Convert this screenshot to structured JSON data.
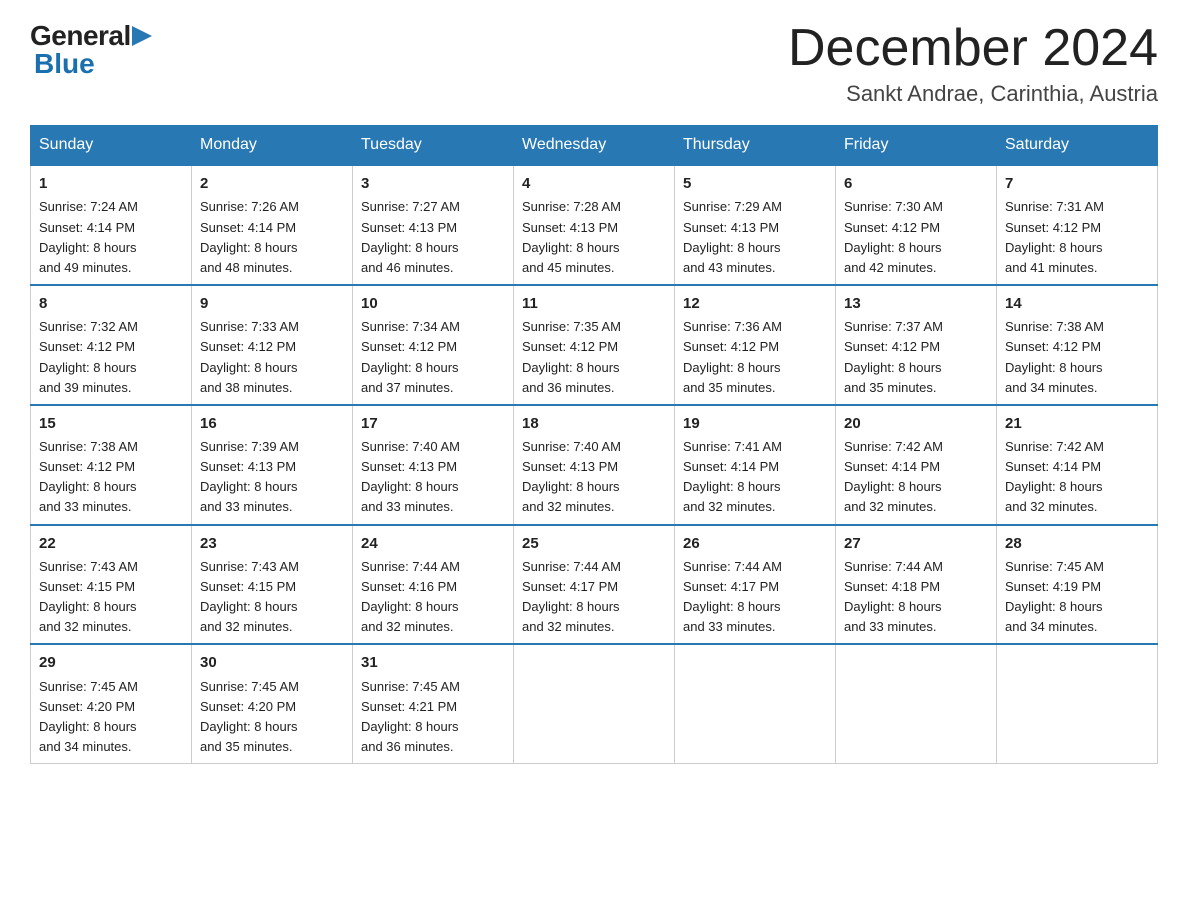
{
  "header": {
    "logo_general": "General",
    "logo_blue": "Blue",
    "month_title": "December 2024",
    "location": "Sankt Andrae, Carinthia, Austria"
  },
  "days_of_week": [
    "Sunday",
    "Monday",
    "Tuesday",
    "Wednesday",
    "Thursday",
    "Friday",
    "Saturday"
  ],
  "weeks": [
    [
      {
        "day": "1",
        "sunrise": "7:24 AM",
        "sunset": "4:14 PM",
        "daylight": "8 hours and 49 minutes."
      },
      {
        "day": "2",
        "sunrise": "7:26 AM",
        "sunset": "4:14 PM",
        "daylight": "8 hours and 48 minutes."
      },
      {
        "day": "3",
        "sunrise": "7:27 AM",
        "sunset": "4:13 PM",
        "daylight": "8 hours and 46 minutes."
      },
      {
        "day": "4",
        "sunrise": "7:28 AM",
        "sunset": "4:13 PM",
        "daylight": "8 hours and 45 minutes."
      },
      {
        "day": "5",
        "sunrise": "7:29 AM",
        "sunset": "4:13 PM",
        "daylight": "8 hours and 43 minutes."
      },
      {
        "day": "6",
        "sunrise": "7:30 AM",
        "sunset": "4:12 PM",
        "daylight": "8 hours and 42 minutes."
      },
      {
        "day": "7",
        "sunrise": "7:31 AM",
        "sunset": "4:12 PM",
        "daylight": "8 hours and 41 minutes."
      }
    ],
    [
      {
        "day": "8",
        "sunrise": "7:32 AM",
        "sunset": "4:12 PM",
        "daylight": "8 hours and 39 minutes."
      },
      {
        "day": "9",
        "sunrise": "7:33 AM",
        "sunset": "4:12 PM",
        "daylight": "8 hours and 38 minutes."
      },
      {
        "day": "10",
        "sunrise": "7:34 AM",
        "sunset": "4:12 PM",
        "daylight": "8 hours and 37 minutes."
      },
      {
        "day": "11",
        "sunrise": "7:35 AM",
        "sunset": "4:12 PM",
        "daylight": "8 hours and 36 minutes."
      },
      {
        "day": "12",
        "sunrise": "7:36 AM",
        "sunset": "4:12 PM",
        "daylight": "8 hours and 35 minutes."
      },
      {
        "day": "13",
        "sunrise": "7:37 AM",
        "sunset": "4:12 PM",
        "daylight": "8 hours and 35 minutes."
      },
      {
        "day": "14",
        "sunrise": "7:38 AM",
        "sunset": "4:12 PM",
        "daylight": "8 hours and 34 minutes."
      }
    ],
    [
      {
        "day": "15",
        "sunrise": "7:38 AM",
        "sunset": "4:12 PM",
        "daylight": "8 hours and 33 minutes."
      },
      {
        "day": "16",
        "sunrise": "7:39 AM",
        "sunset": "4:13 PM",
        "daylight": "8 hours and 33 minutes."
      },
      {
        "day": "17",
        "sunrise": "7:40 AM",
        "sunset": "4:13 PM",
        "daylight": "8 hours and 33 minutes."
      },
      {
        "day": "18",
        "sunrise": "7:40 AM",
        "sunset": "4:13 PM",
        "daylight": "8 hours and 32 minutes."
      },
      {
        "day": "19",
        "sunrise": "7:41 AM",
        "sunset": "4:14 PM",
        "daylight": "8 hours and 32 minutes."
      },
      {
        "day": "20",
        "sunrise": "7:42 AM",
        "sunset": "4:14 PM",
        "daylight": "8 hours and 32 minutes."
      },
      {
        "day": "21",
        "sunrise": "7:42 AM",
        "sunset": "4:14 PM",
        "daylight": "8 hours and 32 minutes."
      }
    ],
    [
      {
        "day": "22",
        "sunrise": "7:43 AM",
        "sunset": "4:15 PM",
        "daylight": "8 hours and 32 minutes."
      },
      {
        "day": "23",
        "sunrise": "7:43 AM",
        "sunset": "4:15 PM",
        "daylight": "8 hours and 32 minutes."
      },
      {
        "day": "24",
        "sunrise": "7:44 AM",
        "sunset": "4:16 PM",
        "daylight": "8 hours and 32 minutes."
      },
      {
        "day": "25",
        "sunrise": "7:44 AM",
        "sunset": "4:17 PM",
        "daylight": "8 hours and 32 minutes."
      },
      {
        "day": "26",
        "sunrise": "7:44 AM",
        "sunset": "4:17 PM",
        "daylight": "8 hours and 33 minutes."
      },
      {
        "day": "27",
        "sunrise": "7:44 AM",
        "sunset": "4:18 PM",
        "daylight": "8 hours and 33 minutes."
      },
      {
        "day": "28",
        "sunrise": "7:45 AM",
        "sunset": "4:19 PM",
        "daylight": "8 hours and 34 minutes."
      }
    ],
    [
      {
        "day": "29",
        "sunrise": "7:45 AM",
        "sunset": "4:20 PM",
        "daylight": "8 hours and 34 minutes."
      },
      {
        "day": "30",
        "sunrise": "7:45 AM",
        "sunset": "4:20 PM",
        "daylight": "8 hours and 35 minutes."
      },
      {
        "day": "31",
        "sunrise": "7:45 AM",
        "sunset": "4:21 PM",
        "daylight": "8 hours and 36 minutes."
      },
      null,
      null,
      null,
      null
    ]
  ]
}
